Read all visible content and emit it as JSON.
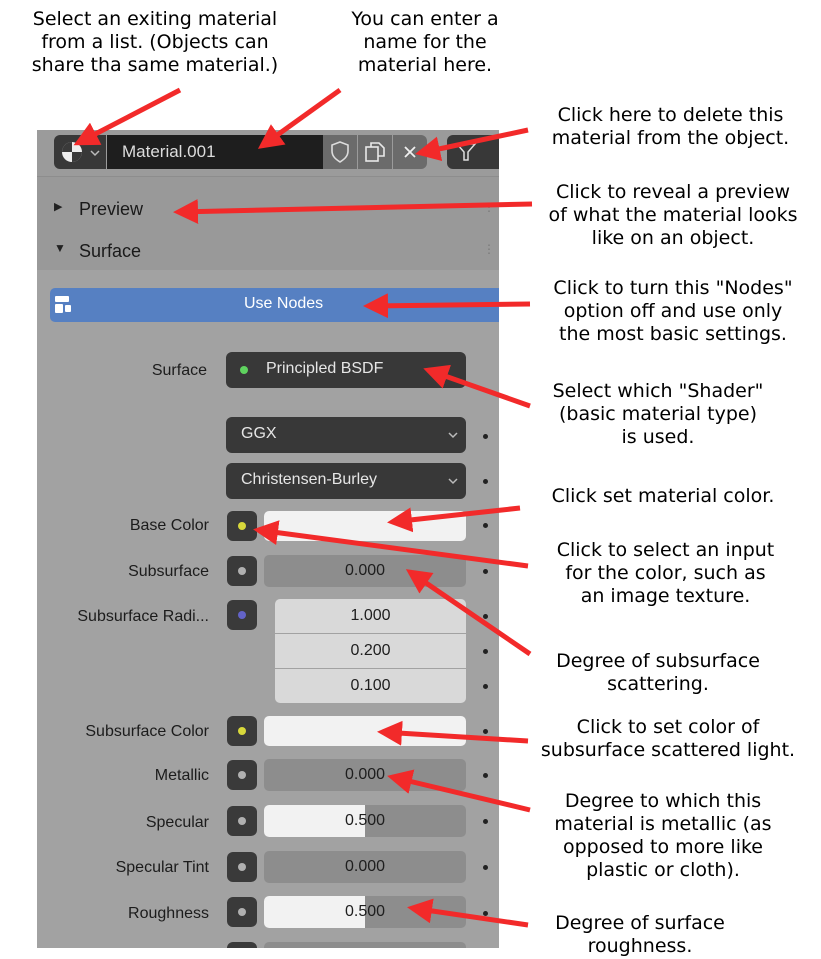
{
  "annotations": {
    "browse": "Select an exiting material\nfrom a list.  (Objects can\nshare tha same material.)",
    "name": "You can enter a\nname for the\nmaterial here.",
    "delete": "Click here to delete this\nmaterial from the object.",
    "preview": "Click to reveal a preview\nof what the material looks\nlike on an object.",
    "nodes": "Click to turn this \"Nodes\"\noption off and use only\nthe most basic settings.",
    "shader": "Select which \"Shader\"\n(basic material type)\nis used.",
    "base_color": "Click set material color.",
    "input": "Click to select an input\nfor the color, such as\nan image texture.",
    "subsurface": "Degree of subsurface\nscattering.",
    "subsurface_color": "Click to set color of\nsubsurface scattered light.",
    "metallic": "Degree to which this\nmaterial is metallic (as\nopposed to more like\nplastic or cloth).",
    "roughness": "Degree of surface\nroughness."
  },
  "colors": {
    "arrow": "#f22a2a",
    "use_nodes": "#5680c2",
    "socket_green": "#5fd35f",
    "socket_yellow": "#d8d83b",
    "socket_gray": "#b0b0b0",
    "socket_blue": "#6363c7"
  },
  "header": {
    "material_name": "Material.001",
    "icons": [
      "sphere-icon",
      "shield-icon",
      "copy-icon",
      "close-icon",
      "funnel-icon"
    ]
  },
  "panels": {
    "preview": "Preview",
    "surface": "Surface"
  },
  "use_nodes_label": "Use Nodes",
  "surface": {
    "label": "Surface",
    "shader": "Principled BSDF"
  },
  "distribution": "GGX",
  "subsurface_method": "Christensen-Burley",
  "properties": {
    "base_color": {
      "label": "Base Color"
    },
    "subsurface": {
      "label": "Subsurface",
      "value": "0.000"
    },
    "subsurface_radius": {
      "label": "Subsurface Radi...",
      "values": [
        "1.000",
        "0.200",
        "0.100"
      ]
    },
    "subsurface_color": {
      "label": "Subsurface Color"
    },
    "metallic": {
      "label": "Metallic",
      "value": "0.000"
    },
    "specular": {
      "label": "Specular",
      "value": "0.500",
      "fill": 0.5
    },
    "specular_tint": {
      "label": "Specular Tint",
      "value": "0.000"
    },
    "roughness": {
      "label": "Roughness",
      "value": "0.500",
      "fill": 0.5
    }
  }
}
